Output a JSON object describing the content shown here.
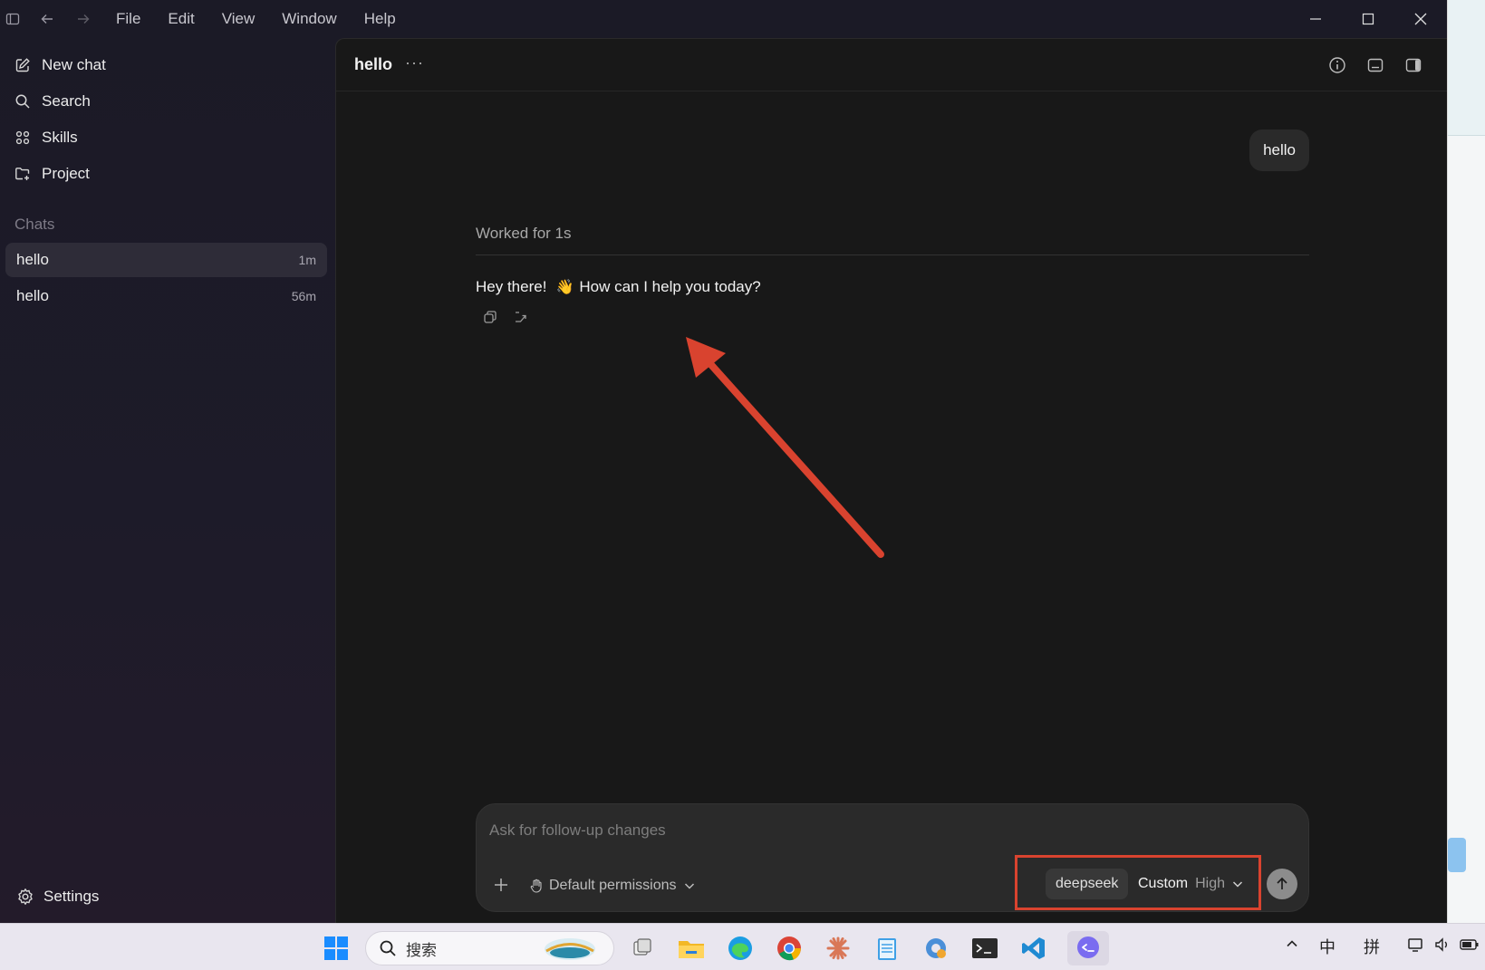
{
  "menu": [
    "File",
    "Edit",
    "View",
    "Window",
    "Help"
  ],
  "sidebar": {
    "nav": [
      {
        "label": "New chat",
        "icon": "compose-icon"
      },
      {
        "label": "Search",
        "icon": "search-icon"
      },
      {
        "label": "Skills",
        "icon": "skills-grid-icon"
      },
      {
        "label": "Project",
        "icon": "folder-plus-icon"
      }
    ],
    "chats_label": "Chats",
    "chats": [
      {
        "title": "hello",
        "time": "1m",
        "active": true
      },
      {
        "title": "hello",
        "time": "56m",
        "active": false
      }
    ],
    "settings_label": "Settings"
  },
  "main": {
    "title": "hello",
    "more": "···",
    "user_message": "hello",
    "worked_label": "Worked for 1s",
    "reply_before": "Hey there!",
    "reply_emoji": "👋",
    "reply_after": "How can I help you today?"
  },
  "composer": {
    "placeholder": "Ask for follow-up changes",
    "permissions_label": "Default permissions",
    "model": "deepseek",
    "mode": "Custom",
    "effort": "High"
  },
  "taskbar": {
    "search_label": "搜索",
    "ime_lang": "中",
    "ime_mode": "拼"
  },
  "colors": {
    "annotation": "#d9432f",
    "main_bg": "#181818",
    "sidebar_bg": "#1b1a26"
  }
}
